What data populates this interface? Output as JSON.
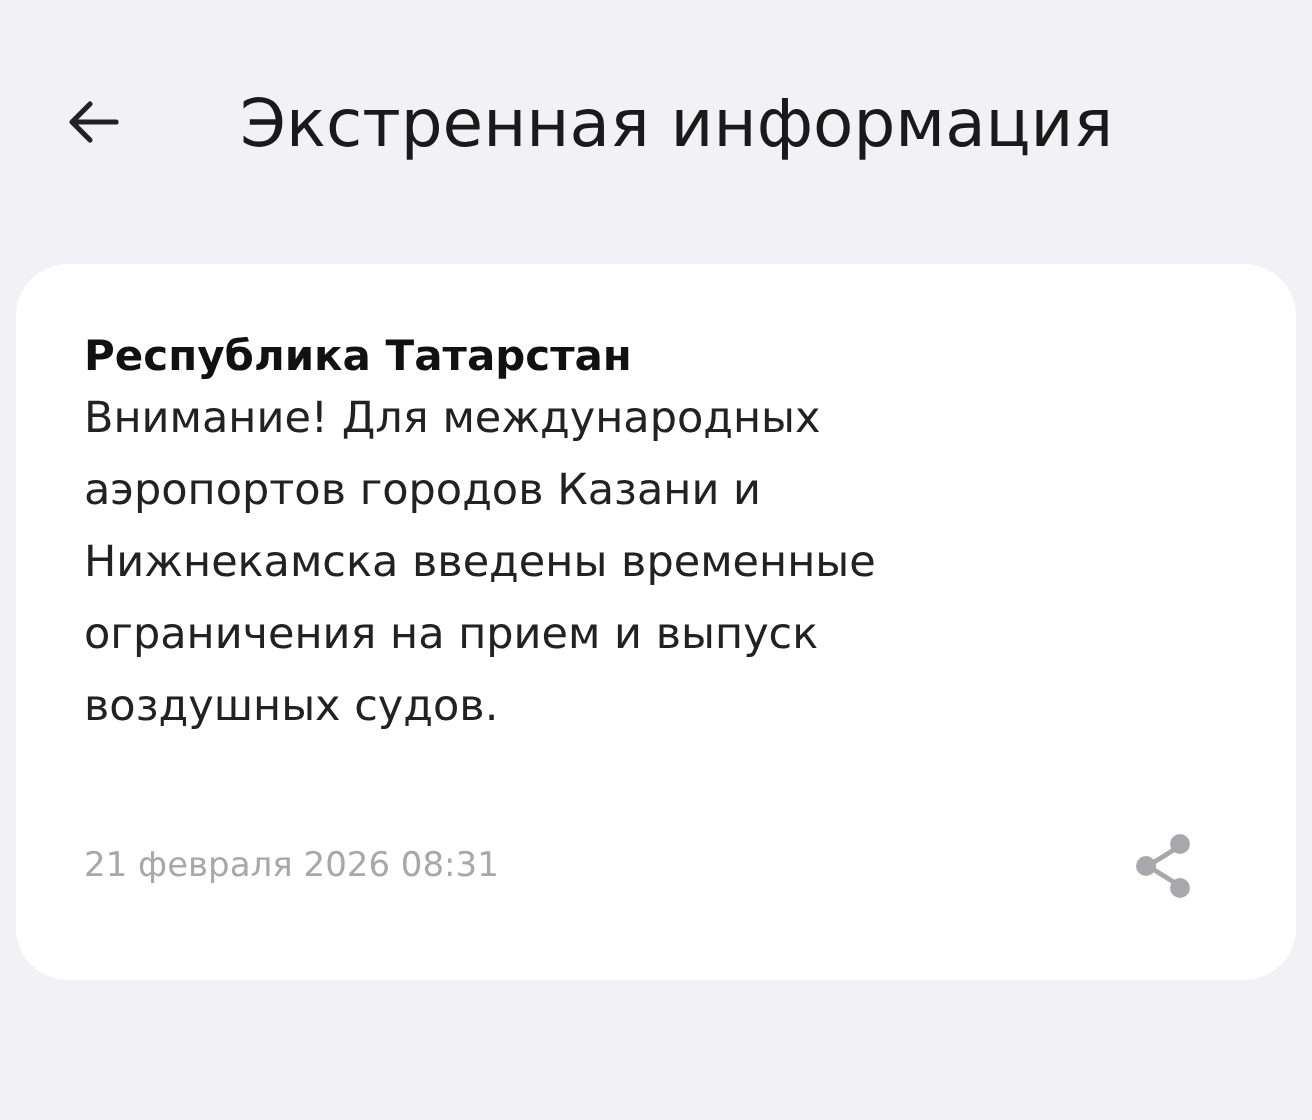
{
  "header": {
    "title": "Экстренная информация"
  },
  "alert": {
    "region": "Республика Татарстан",
    "message": "Внимание! Для международных аэропортов городов Казани и Нижнекамска введены временные ограничения на прием и выпуск воздушных судов.",
    "date": "21 февраля 2026 08:31"
  }
}
